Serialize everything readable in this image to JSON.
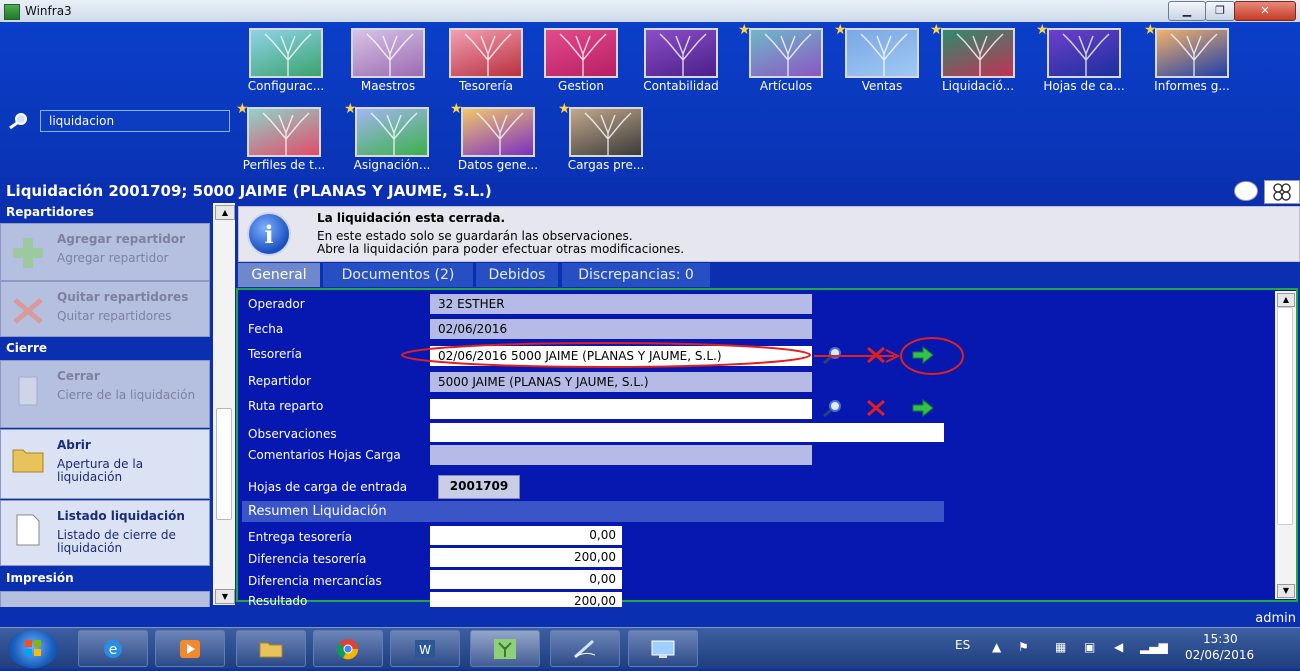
{
  "window": {
    "title": "Winfra3",
    "minimize": "▁",
    "maximize": "❐",
    "close": "✕"
  },
  "search": {
    "value": "liquidacion"
  },
  "tiles_row1": [
    {
      "label": "Configurac...",
      "star": false,
      "c1": "#8fd3e8",
      "c2": "#3aa36d"
    },
    {
      "label": "Maestros",
      "star": false,
      "c1": "#d7c3e8",
      "c2": "#9b6bb0"
    },
    {
      "label": "Tesorería",
      "star": false,
      "c1": "#f3a0b2",
      "c2": "#b82f3f"
    },
    {
      "label": "Gestion",
      "star": false,
      "c1": "#e24b8c",
      "c2": "#b81f63"
    },
    {
      "label": "Contabilidad",
      "star": false,
      "c1": "#8b4fc7",
      "c2": "#4b1f8a"
    },
    {
      "label": "Artículos",
      "star": true,
      "c1": "#6fb8c9",
      "c2": "#8b56c2"
    },
    {
      "label": "Ventas",
      "star": true,
      "c1": "#7ba7e6",
      "c2": "#9fc9f2"
    },
    {
      "label": "Liquidació...",
      "star": true,
      "c1": "#2c8c6f",
      "c2": "#c23255"
    },
    {
      "label": "Hojas de ca...",
      "star": true,
      "c1": "#6e3fc9",
      "c2": "#1a2f9e"
    },
    {
      "label": "Informes g...",
      "star": true,
      "c1": "#f2b26b",
      "c2": "#1e3ea8"
    }
  ],
  "tiles_row2": [
    {
      "label": "Perfiles de t...",
      "star": true,
      "c1": "#8fd3c8",
      "c2": "#e24b6b"
    },
    {
      "label": "Asignación...",
      "star": true,
      "c1": "#a3b6f2",
      "c2": "#3bb04a"
    },
    {
      "label": "Datos gene...",
      "star": true,
      "c1": "#f2c76b",
      "c2": "#7a2fc2"
    },
    {
      "label": "Cargas pre...",
      "star": true,
      "c1": "#c2a88a",
      "c2": "#3a3a3a"
    }
  ],
  "page_title": "Liquidación 2001709; 5000 JAIME (PLANAS Y JAUME, S.L.)",
  "sidebar": {
    "group_repartidores": "Repartidores",
    "add_title": "Agregar repartidor",
    "add_sub": "Agregar repartidor",
    "remove_title": "Quitar repartidores",
    "remove_sub": "Quitar repartidores",
    "group_cierre": "Cierre",
    "close_title": "Cerrar",
    "close_sub": "Cierre de la liquidación",
    "open_title": "Abrir",
    "open_sub": "Apertura de la liquidación",
    "list_title": "Listado liquidación",
    "list_sub": "Listado de cierre de liquidación",
    "group_impresion": "Impresión",
    "scroll_up": "▲",
    "scroll_down": "▼"
  },
  "info": {
    "line1": "La liquidación esta cerrada.",
    "line2": "En este estado solo se guardarán las observaciones.",
    "line3": "Abre la liquidación para poder efectuar otras modificaciones.",
    "icon": "i"
  },
  "tabs": [
    "General",
    "Documentos (2)",
    "Debidos",
    "Discrepancias: 0"
  ],
  "form": {
    "operador_label": "Operador",
    "operador_value": "32 ESTHER",
    "fecha_label": "Fecha",
    "fecha_value": "02/06/2016",
    "tesoreria_label": "Tesorería",
    "tesoreria_value": "02/06/2016 5000 JAIME (PLANAS Y JAUME, S.L.)",
    "repartidor_label": "Repartidor",
    "repartidor_value": "5000 JAIME (PLANAS Y JAUME, S.L.)",
    "ruta_label": "Ruta reparto",
    "ruta_value": "",
    "observaciones_label": "Observaciones",
    "observaciones_value": "",
    "comentarios_label": "Comentarios Hojas Carga",
    "comentarios_value": "",
    "hojas_label": "Hojas de carga de entrada",
    "hojas_value": "2001709"
  },
  "resumen": {
    "header": "Resumen Liquidación",
    "entrega_label": "Entrega tesorería",
    "entrega_value": "0,00",
    "diftes_label": "Diferencia tesorería",
    "diftes_value": "200,00",
    "difmer_label": "Diferencia mercancías",
    "difmer_value": "0,00",
    "resultado_label": "Resultado",
    "resultado_value": "200,00"
  },
  "content_scroll": {
    "up": "▲",
    "down": "▼"
  },
  "status": {
    "user": "admin"
  },
  "taskbar": {
    "lang": "ES",
    "time": "15:30",
    "date": "02/06/2016"
  },
  "colors": {
    "accent": "#0a2fb0",
    "highlight_red": "#e02020",
    "ok_green": "#1ea84a"
  }
}
